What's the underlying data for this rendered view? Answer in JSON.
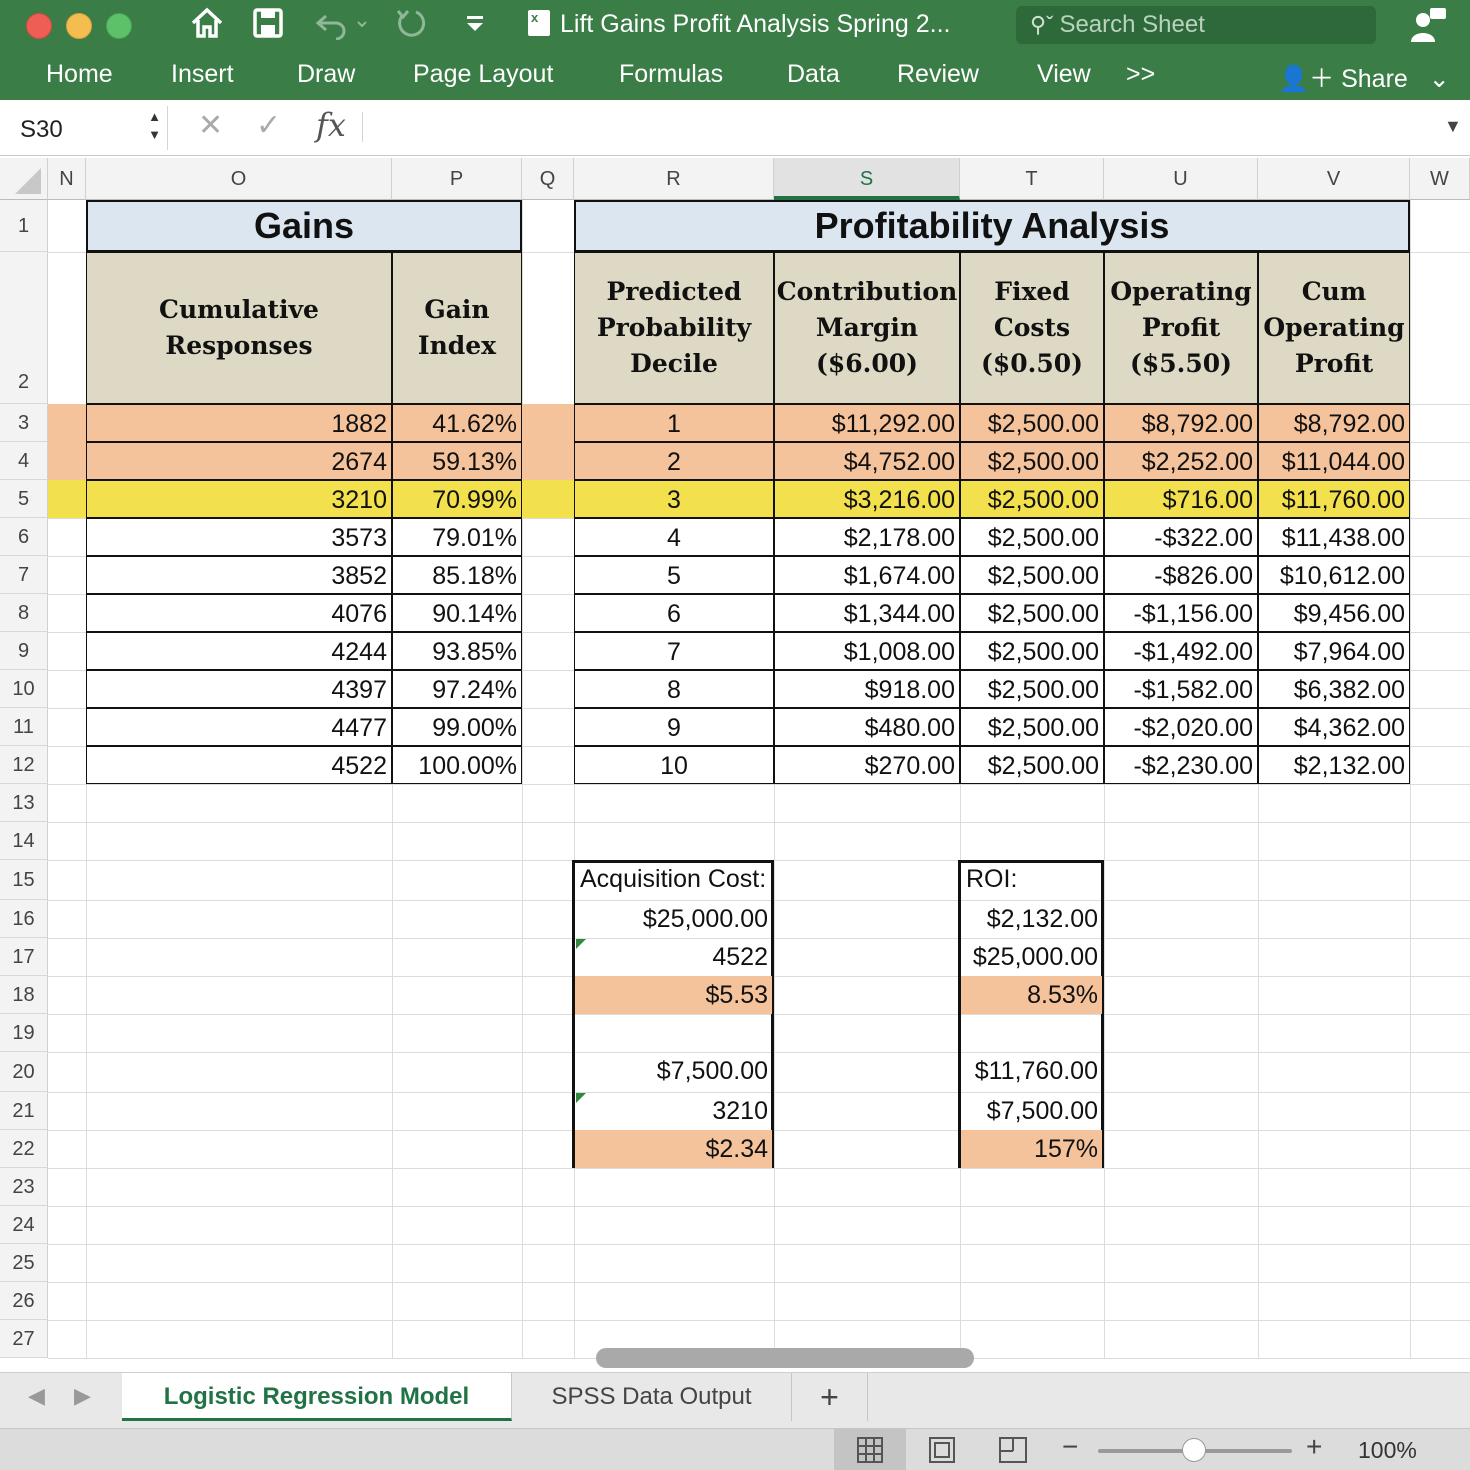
{
  "window": {
    "title": "Lift Gains Profit Analysis Spring 2...",
    "search_placeholder": "Search Sheet",
    "share_label": "Share",
    "accent": "#3a7d46"
  },
  "ribbon_tabs": [
    "Home",
    "Insert",
    "Draw",
    "Page Layout",
    "Formulas",
    "Data",
    "Review",
    "View",
    ">>"
  ],
  "formula_bar": {
    "name_box": "S30",
    "fx": "fx",
    "value": ""
  },
  "columns": [
    "N",
    "O",
    "P",
    "Q",
    "R",
    "S",
    "T",
    "U",
    "V",
    "W"
  ],
  "selected_column": "S",
  "rows": [
    "1",
    "2",
    "3",
    "4",
    "5",
    "6",
    "7",
    "8",
    "9",
    "10",
    "11",
    "12",
    "13",
    "14",
    "15",
    "16",
    "17",
    "18",
    "19",
    "20",
    "21",
    "22",
    "23",
    "24",
    "25",
    "26",
    "27"
  ],
  "gains": {
    "title": "Gains",
    "headers": [
      "Cumulative Responses",
      "Gain Index"
    ],
    "rows": [
      [
        "1882",
        "41.62%"
      ],
      [
        "2674",
        "59.13%"
      ],
      [
        "3210",
        "70.99%"
      ],
      [
        "3573",
        "79.01%"
      ],
      [
        "3852",
        "85.18%"
      ],
      [
        "4076",
        "90.14%"
      ],
      [
        "4244",
        "93.85%"
      ],
      [
        "4397",
        "97.24%"
      ],
      [
        "4477",
        "99.00%"
      ],
      [
        "4522",
        "100.00%"
      ]
    ]
  },
  "profit": {
    "title": "Profitability Analysis",
    "headers": [
      [
        "Predicted",
        "Probability",
        "Decile"
      ],
      [
        "Contribution",
        "Margin",
        "($6.00)"
      ],
      [
        "Fixed",
        "Costs",
        "($0.50)"
      ],
      [
        "Operating",
        "Profit",
        "($5.50)"
      ],
      [
        "Cum",
        "Operating",
        "Profit"
      ]
    ],
    "rows": [
      [
        "1",
        "$11,292.00",
        "$2,500.00",
        "$8,792.00",
        "$8,792.00"
      ],
      [
        "2",
        "$4,752.00",
        "$2,500.00",
        "$2,252.00",
        "$11,044.00"
      ],
      [
        "3",
        "$3,216.00",
        "$2,500.00",
        "$716.00",
        "$11,760.00"
      ],
      [
        "4",
        "$2,178.00",
        "$2,500.00",
        "-$322.00",
        "$11,438.00"
      ],
      [
        "5",
        "$1,674.00",
        "$2,500.00",
        "-$826.00",
        "$10,612.00"
      ],
      [
        "6",
        "$1,344.00",
        "$2,500.00",
        "-$1,156.00",
        "$9,456.00"
      ],
      [
        "7",
        "$1,008.00",
        "$2,500.00",
        "-$1,492.00",
        "$7,964.00"
      ],
      [
        "8",
        "$918.00",
        "$2,500.00",
        "-$1,582.00",
        "$6,382.00"
      ],
      [
        "9",
        "$480.00",
        "$2,500.00",
        "-$2,020.00",
        "$4,362.00"
      ],
      [
        "10",
        "$270.00",
        "$2,500.00",
        "-$2,230.00",
        "$2,132.00"
      ]
    ]
  },
  "acquisition": {
    "label": "Acquisition Cost:",
    "values": [
      "$25,000.00",
      "4522",
      "$5.53",
      "",
      "$7,500.00",
      "3210",
      "$2.34"
    ]
  },
  "roi": {
    "label": "ROI:",
    "values": [
      "$2,132.00",
      "$25,000.00",
      "8.53%",
      "",
      "$11,760.00",
      "$7,500.00",
      "157%"
    ]
  },
  "sheets": [
    "Logistic Regression Model",
    "SPSS Data Output"
  ],
  "add_sheet": "+",
  "zoom": "100%",
  "colors": {
    "peach": "#f4c39b",
    "yellow": "#f3e04d",
    "header_blue": "#dce6f1",
    "header_tan": "#ddd9c4"
  }
}
